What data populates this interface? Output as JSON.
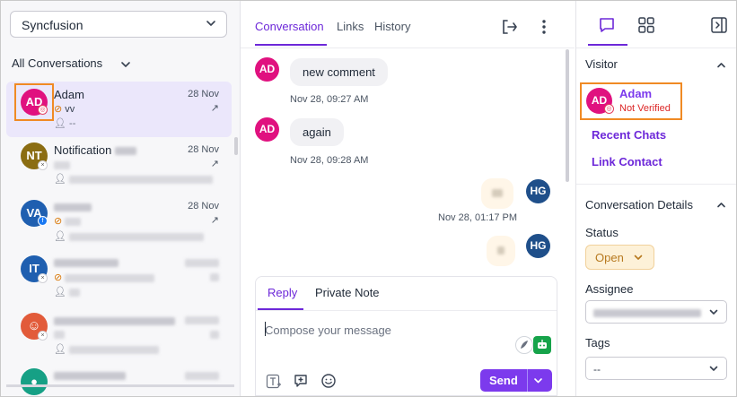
{
  "left": {
    "account": "Syncfusion",
    "filter_label": "All Conversations",
    "conversations": [
      {
        "initials": "AD",
        "name": "Adam",
        "date": "28 Nov",
        "preview": "vv",
        "sub": "--",
        "avatar_color": "#e0117f",
        "channel": "instagram",
        "active": true
      },
      {
        "initials": "NT",
        "name": "Notification",
        "date": "28 Nov",
        "preview": "",
        "sub": "",
        "avatar_color": "#8b6d12",
        "channel": "web",
        "active": false
      },
      {
        "initials": "VA",
        "name": "",
        "date": "28 Nov",
        "preview": "",
        "sub": "",
        "avatar_color": "#1f5fb0",
        "channel": "facebook",
        "active": false
      },
      {
        "initials": "IT",
        "name": "",
        "date": "",
        "preview": "",
        "sub": "",
        "avatar_color": "#1f5fb0",
        "channel": "web",
        "active": false
      },
      {
        "initials": "",
        "name": "",
        "date": "",
        "preview": "",
        "sub": "",
        "avatar_color": "#e25b3a",
        "channel": "web",
        "active": false
      },
      {
        "initials": "",
        "name": "",
        "date": "",
        "preview": "",
        "sub": "",
        "avatar_color": "#16a085",
        "channel": "web",
        "active": false
      }
    ]
  },
  "middle": {
    "tabs": [
      "Conversation",
      "Links",
      "History"
    ],
    "active_tab": "Conversation",
    "messages": [
      {
        "initials": "AD",
        "text": "new comment",
        "time": "Nov 28, 09:27 AM",
        "direction": "in"
      },
      {
        "initials": "AD",
        "text": "again",
        "time": "Nov 28, 09:28 AM",
        "direction": "in"
      },
      {
        "initials": "HG",
        "text": "",
        "time": "Nov 28, 01:17 PM",
        "direction": "out"
      },
      {
        "initials": "HG",
        "text": "",
        "time": "",
        "direction": "out"
      }
    ],
    "composer": {
      "tabs": [
        "Reply",
        "Private Note"
      ],
      "active_tab": "Reply",
      "placeholder": "Compose your message",
      "send_label": "Send"
    }
  },
  "right": {
    "visitor_title": "Visitor",
    "visitor": {
      "initials": "AD",
      "name": "Adam",
      "status": "Not Verified"
    },
    "links": [
      "Recent Chats",
      "Link Contact"
    ],
    "details_title": "Conversation Details",
    "status_label": "Status",
    "status_value": "Open",
    "assignee_label": "Assignee",
    "assignee_value": "",
    "tags_label": "Tags",
    "tags_value": "--"
  },
  "colors": {
    "accent": "#6d28d9",
    "highlight": "#f08a24",
    "status_open_bg": "#fdf1d8",
    "status_open_text": "#b7791f",
    "not_verified": "#dc2626"
  }
}
